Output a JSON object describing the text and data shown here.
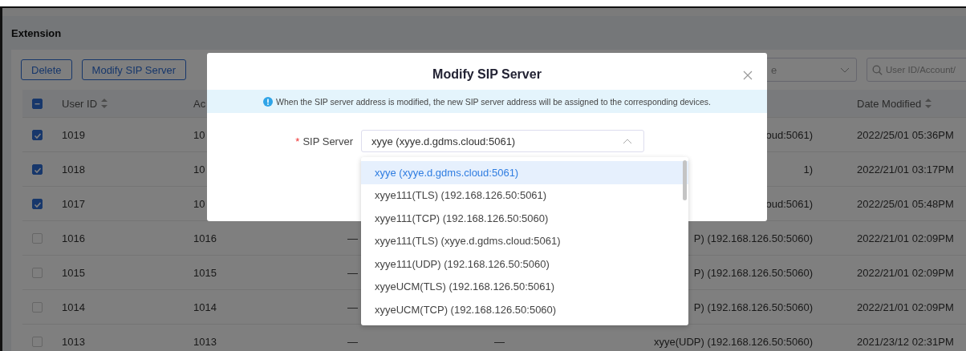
{
  "page_title": "Extension",
  "toolbar": {
    "buttons": [
      "Delete",
      "Modify SIP Server"
    ],
    "filter_select": {
      "value": "e"
    },
    "search": {
      "placeholder": "User ID/Account/"
    }
  },
  "table": {
    "select_all": {
      "indeterminate": true
    },
    "columns": {
      "user_id": {
        "label": "User ID",
        "sortable": true
      },
      "account": {
        "label": "Ac",
        "sortable": false
      },
      "date_modified": {
        "label": "Date Modified",
        "sortable": true
      }
    },
    "rows": [
      {
        "checked": true,
        "user_id": "1019",
        "account": "10",
        "sip_server": "oud:5061)",
        "date_modified": "2022/25/01 05:36PM"
      },
      {
        "checked": true,
        "user_id": "1018",
        "account": "10",
        "sip_server": "1)",
        "date_modified": "2022/21/01 03:17PM"
      },
      {
        "checked": true,
        "user_id": "1017",
        "account": "10",
        "sip_server": "oud:5061)",
        "date_modified": "2022/25/01 05:48PM"
      },
      {
        "checked": false,
        "user_id": "1016",
        "account": "1016",
        "column_3": "—",
        "sip_server": "P) (192.168.126.50:5060)",
        "date_modified": "2022/21/01 02:09PM"
      },
      {
        "checked": false,
        "user_id": "1015",
        "account": "1015",
        "column_3": "—",
        "sip_server": "P) (192.168.126.50:5060)",
        "date_modified": "2022/21/01 02:09PM"
      },
      {
        "checked": false,
        "user_id": "1014",
        "account": "1014",
        "column_3": "—",
        "sip_server": "P) (192.168.126.50:5060)",
        "date_modified": "2022/21/01 02:09PM"
      },
      {
        "checked": false,
        "user_id": "1013",
        "account": "1013",
        "column_3": "—",
        "column_4": "—",
        "sip_server": "xyye(UDP) (192.168.126.50:5060)",
        "date_modified": "2021/23/12 02:31PM"
      }
    ]
  },
  "modal": {
    "title": "Modify SIP Server",
    "notice": "When the SIP server address is modified, the new SIP server address will be assigned to the corresponding devices.",
    "field": {
      "required_mark": "*",
      "label": "SIP Server",
      "value": "xyye (xyye.d.gdms.cloud:5061)",
      "expanded": true
    },
    "options": [
      {
        "label": "xyye (xyye.d.gdms.cloud:5061)",
        "selected": true
      },
      {
        "label": "xyye111(TLS) (192.168.126.50:5061)",
        "selected": false
      },
      {
        "label": "xyye111(TCP) (192.168.126.50:5060)",
        "selected": false
      },
      {
        "label": "xyye111(TLS) (xyye.d.gdms.cloud:5061)",
        "selected": false
      },
      {
        "label": "xyye111(UDP) (192.168.126.50:5060)",
        "selected": false
      },
      {
        "label": "xyyeUCM(TLS) (192.168.126.50:5061)",
        "selected": false
      },
      {
        "label": "xyyeUCM(TCP) (192.168.126.50:5060)",
        "selected": false
      }
    ]
  }
}
